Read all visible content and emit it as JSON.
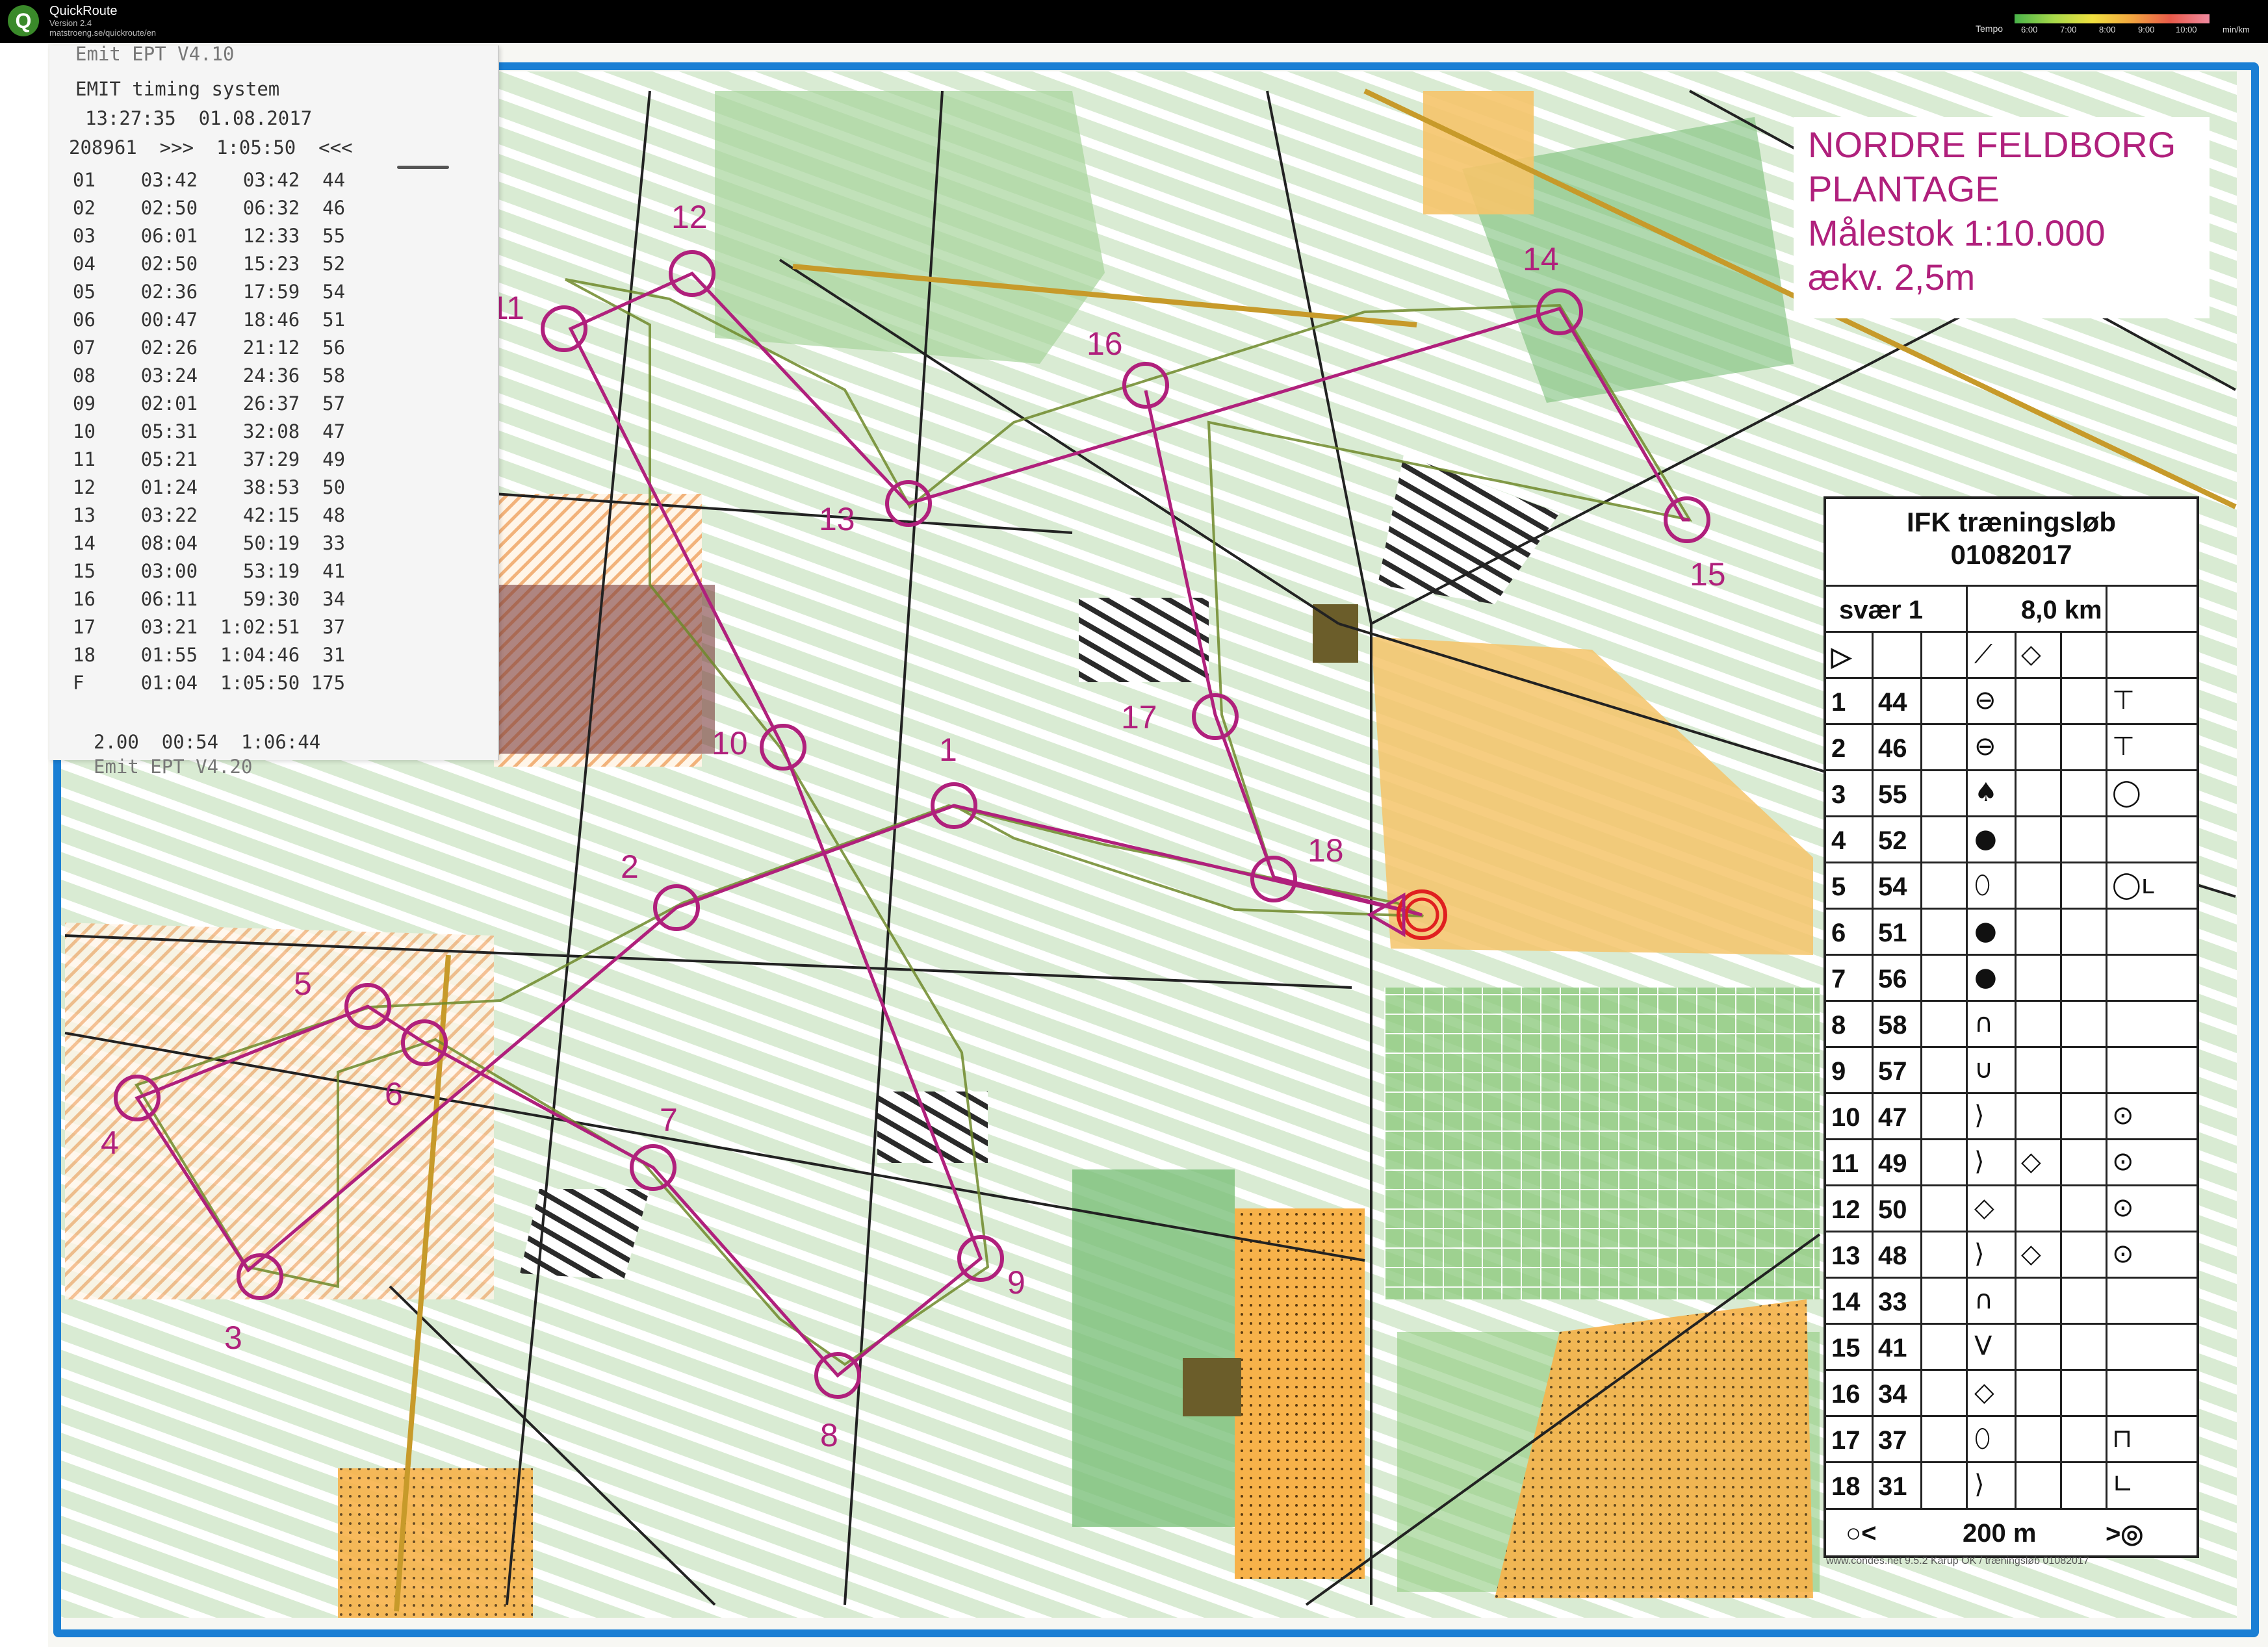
{
  "app": {
    "logo": "Q",
    "title": "QuickRoute",
    "version": "Version 2.4",
    "url": "matstroeng.se/quickroute/en",
    "tempo_label": "Tempo",
    "tempo_ticks": [
      "6:00",
      "7:00",
      "8:00",
      "9:00",
      "10:00"
    ],
    "tempo_unit": "min/km"
  },
  "map_title": {
    "line1": "NORDRE FELDBORG",
    "line2": "PLANTAGE",
    "line3": "Målestok 1:10.000",
    "line4": "ækv. 2,5m"
  },
  "receipt": {
    "cut_top": "Emit EPT V4.10",
    "header": "EMIT timing system",
    "datetime": "13:27:35  01.08.2017",
    "card_line": "208961  >>>  1:05:50  <<<",
    "splits": [
      "01    03:42    03:42  44",
      "02    02:50    06:32  46",
      "03    06:01    12:33  55",
      "04    02:50    15:23  52",
      "05    02:36    17:59  54",
      "06    00:47    18:46  51",
      "07    02:26    21:12  56",
      "08    03:24    24:36  58",
      "09    02:01    26:37  57",
      "10    05:31    32:08  47",
      "11    05:21    37:29  49",
      "12    01:24    38:53  50",
      "13    03:22    42:15  48",
      "14    08:04    50:19  33",
      "15    03:00    53:19  41",
      "16    06:11    59:30  34",
      "17    03:21  1:02:51  37",
      "18    01:55  1:04:46  31",
      "F     01:04  1:05:50 175"
    ],
    "footer": "2.00  00:54  1:06:44",
    "cut_bottom": "Emit EPT V4.20"
  },
  "control_description": {
    "title": "IFK træningsløb",
    "date": "01082017",
    "course": "svær 1",
    "length": "8,0 km",
    "start_symbol": "▷",
    "start_feature": "⟋",
    "start_extra": "◇",
    "rows": [
      {
        "num": "1",
        "code": "44",
        "sym": "⊖",
        "sym2": "",
        "extra": "⊤"
      },
      {
        "num": "2",
        "code": "46",
        "sym": "⊖",
        "sym2": "",
        "extra": "⊤"
      },
      {
        "num": "3",
        "code": "55",
        "sym": "♠",
        "sym2": "",
        "extra": "◯"
      },
      {
        "num": "4",
        "code": "52",
        "sym": "●",
        "sym2": "",
        "extra": ""
      },
      {
        "num": "5",
        "code": "54",
        "sym": "⬯",
        "sym2": "",
        "extra": "◯ʟ"
      },
      {
        "num": "6",
        "code": "51",
        "sym": "●",
        "sym2": "",
        "extra": ""
      },
      {
        "num": "7",
        "code": "56",
        "sym": "●",
        "sym2": "",
        "extra": ""
      },
      {
        "num": "8",
        "code": "58",
        "sym": "∩",
        "sym2": "",
        "extra": ""
      },
      {
        "num": "9",
        "code": "57",
        "sym": "∪",
        "sym2": "",
        "extra": ""
      },
      {
        "num": "10",
        "code": "47",
        "sym": "⟩",
        "sym2": "",
        "extra": "⊙"
      },
      {
        "num": "11",
        "code": "49",
        "sym": "⟩",
        "sym2": "◇",
        "extra": "⊙"
      },
      {
        "num": "12",
        "code": "50",
        "sym": "◇",
        "sym2": "",
        "extra": "⊙"
      },
      {
        "num": "13",
        "code": "48",
        "sym": "⟩",
        "sym2": "◇",
        "extra": "⊙"
      },
      {
        "num": "14",
        "code": "33",
        "sym": "∩",
        "sym2": "",
        "extra": ""
      },
      {
        "num": "15",
        "code": "41",
        "sym": "V",
        "sym2": "",
        "extra": ""
      },
      {
        "num": "16",
        "code": "34",
        "sym": "◇",
        "sym2": "",
        "extra": ""
      },
      {
        "num": "17",
        "code": "37",
        "sym": "⬯",
        "sym2": "",
        "extra": "⊓"
      },
      {
        "num": "18",
        "code": "31",
        "sym": "⟩",
        "sym2": "",
        "extra": "∟"
      }
    ],
    "finish_left": "○<",
    "finish_distance": "200 m",
    "finish_right": ">◎"
  },
  "controls": [
    {
      "num": "1"
    },
    {
      "num": "2"
    },
    {
      "num": "3"
    },
    {
      "num": "4"
    },
    {
      "num": "5"
    },
    {
      "num": "6"
    },
    {
      "num": "7"
    },
    {
      "num": "8"
    },
    {
      "num": "9"
    },
    {
      "num": "10"
    },
    {
      "num": "11"
    },
    {
      "num": "12"
    },
    {
      "num": "13"
    },
    {
      "num": "14"
    },
    {
      "num": "15"
    },
    {
      "num": "16"
    },
    {
      "num": "17"
    },
    {
      "num": "18"
    }
  ],
  "colors": {
    "course": "#b0207c",
    "frame": "#1a7fd4",
    "forest": "#7cc07a",
    "open": "#f5c46a"
  },
  "footer_text": "www.condes.net 9.5.2 Karup OK / træningsløb 01082017"
}
